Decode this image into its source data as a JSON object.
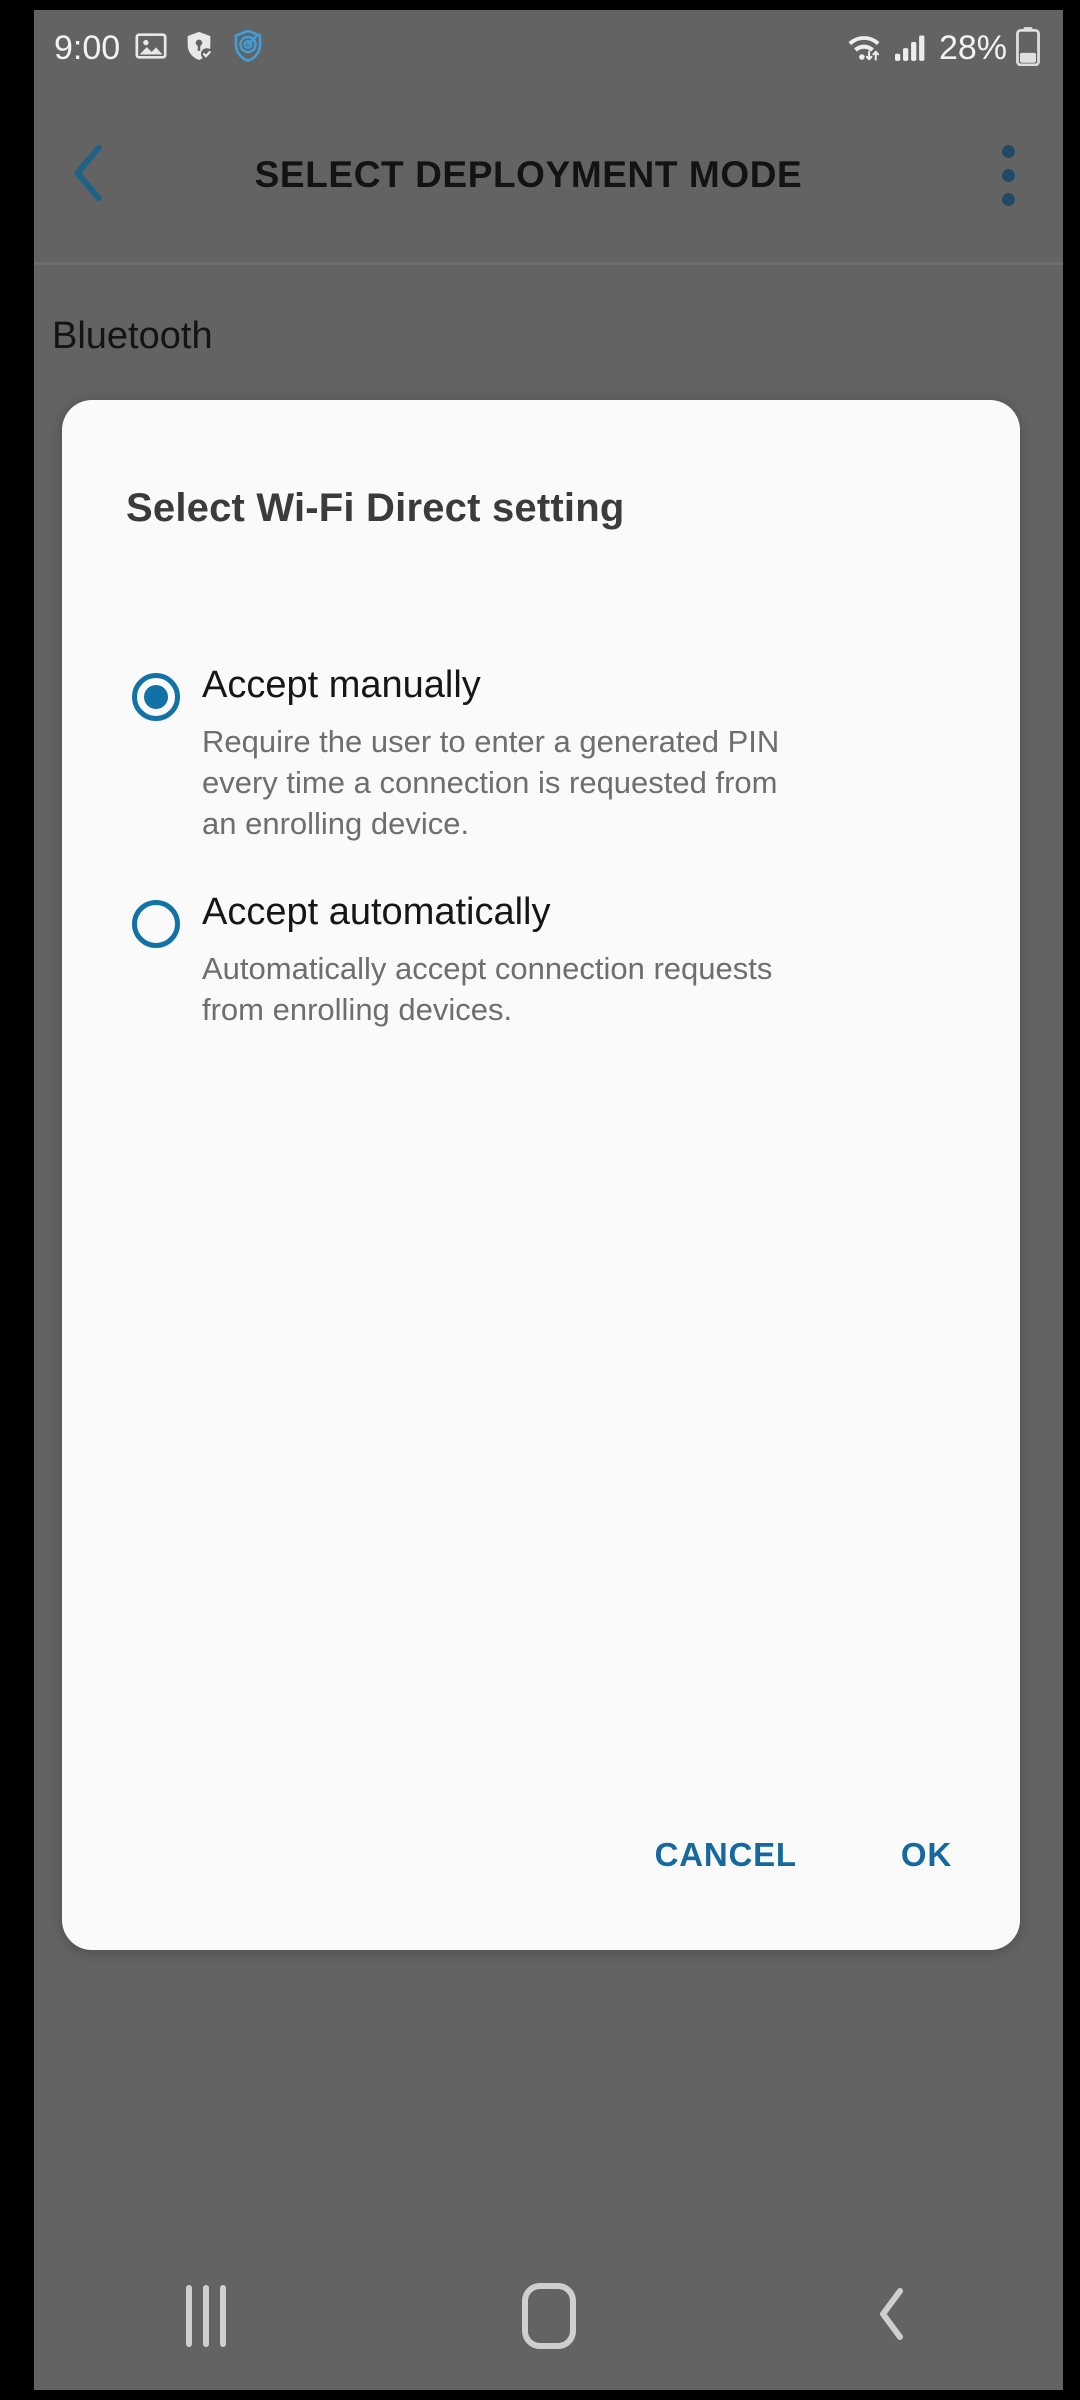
{
  "status_bar": {
    "time": "9:00",
    "left_icons": [
      "image-icon",
      "knox-shield-key-icon",
      "knox-shield-target-icon"
    ],
    "wifi_icon": "wifi-icon",
    "signal_icon": "cellular-signal-icon",
    "battery_percent": "28%",
    "battery_icon": "battery-icon"
  },
  "app_bar": {
    "back_icon": "back-chevron-icon",
    "title": "SELECT DEPLOYMENT MODE",
    "overflow_icon": "overflow-menu-icon"
  },
  "background": {
    "section_label": "Bluetooth"
  },
  "dialog": {
    "title": "Select Wi-Fi Direct setting",
    "options": [
      {
        "label": "Accept manually",
        "description": "Require the user to enter a generated PIN every time a connection is requested from an enrolling device.",
        "selected": true
      },
      {
        "label": "Accept automatically",
        "description": "Automatically accept connection requests from enrolling devices.",
        "selected": false
      }
    ],
    "cancel_label": "CANCEL",
    "ok_label": "OK"
  },
  "nav_bar": {
    "recents_icon": "recents-icon",
    "home_icon": "home-icon",
    "back_icon": "nav-back-icon"
  },
  "colors": {
    "accent": "#15699e",
    "radio": "#1272a6",
    "scrim": "#636363",
    "dialog_bg": "#fafafa",
    "title_text": "#111314"
  }
}
